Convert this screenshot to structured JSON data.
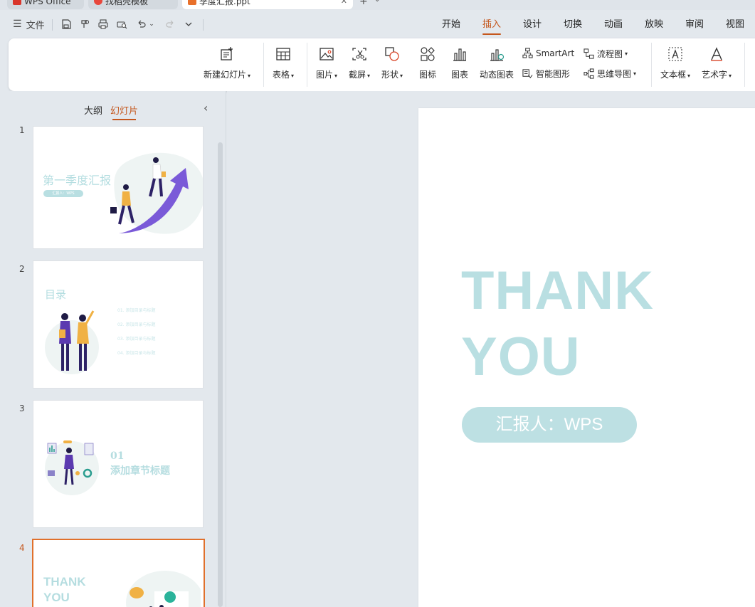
{
  "tabs": [
    {
      "label": "WPS Office",
      "icon": "wps-logo-icon"
    },
    {
      "label": "找稻壳模板",
      "icon": "docer-icon"
    },
    {
      "label": "季度汇报.ppt",
      "icon": "ppt-file-icon"
    }
  ],
  "quickbar": {
    "file_label": "文件"
  },
  "menu_tabs": [
    "开始",
    "插入",
    "设计",
    "切换",
    "动画",
    "放映",
    "审阅",
    "视图"
  ],
  "ribbon": {
    "new_slide": "新建幻灯片",
    "table": "表格",
    "picture": "图片",
    "screenshot": "截屏",
    "shape": "形状",
    "icon": "图标",
    "chart": "图表",
    "dynamic_chart": "动态图表",
    "smartart": "SmartArt",
    "smart_graphic": "智能图形",
    "flowchart": "流程图",
    "mindmap": "思维导图",
    "textbox": "文本框",
    "wordart": "艺术字"
  },
  "panel": {
    "outline_tab": "大纲",
    "slides_tab": "幻灯片"
  },
  "slides": [
    {
      "number": "1",
      "title": "第一季度汇报",
      "sub": "汇报人：WPS"
    },
    {
      "number": "2",
      "title": "目录",
      "items": [
        "01. 添加目录与标题",
        "02. 添加目录与标题",
        "03. 添加目录与标题",
        "04. 添加目录与标题"
      ]
    },
    {
      "number": "3",
      "num": "01",
      "title": "添加章节标题"
    },
    {
      "number": "4",
      "line1": "THANK",
      "line2": "YOU"
    }
  ],
  "main_slide": {
    "line1": "THANK",
    "line2": "YOU",
    "reporter": "汇报人：WPS"
  },
  "colors": {
    "accent": "#c5571d",
    "slide_text": "#b9dfe2",
    "selection_border": "#e0702c"
  }
}
